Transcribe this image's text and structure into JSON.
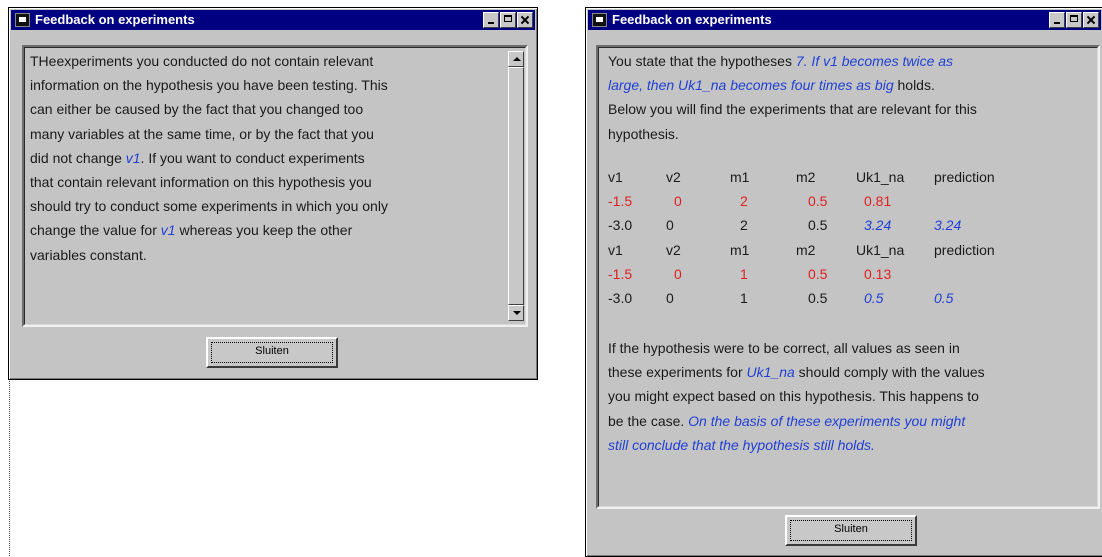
{
  "left_window": {
    "title": "Feedback on experiments",
    "text": [
      {
        "t": "THeexperiments you conducted do not contain relevant"
      },
      {
        "t": "information on the hypothesis you have been testing. This"
      },
      {
        "t": "can either be caused by the fact that you changed too"
      },
      {
        "t": "many variables at the same time, or by the fact that you"
      },
      {
        "a": "did not change ",
        "b": "v1",
        "c": ".  If you want to conduct experiments"
      },
      {
        "t": "that contain relevant information on this hypothesis you"
      },
      {
        "t": "should try to conduct some experiments in which you only"
      },
      {
        "a": "change the value for ",
        "b": "v1",
        "c": " whereas you keep the other"
      },
      {
        "t": "variables constant."
      }
    ],
    "button": "Sluiten"
  },
  "right_window": {
    "title": "Feedback on experiments",
    "intro": {
      "line1_a": "You state that the hypotheses ",
      "line1_b": "7. If v1 becomes twice as",
      "line2_b": "large, then Uk1_na becomes four times as big",
      "line2_c": " holds.",
      "line3": "Below you will find the experiments that are relevant for this",
      "line4": "hypothesis."
    },
    "tables": [
      {
        "headers": [
          "v1",
          "v2",
          "m1",
          "m2",
          "Uk1_na",
          "prediction"
        ],
        "rows": [
          {
            "v1": "-1.5",
            "v2": "0",
            "m1": "2",
            "m2": "0.5",
            "uk": "0.81",
            "pred": ""
          },
          {
            "v1": "-3.0",
            "v2": "0",
            "m1": "2",
            "m2": "0.5",
            "uk": "3.24",
            "pred": "3.24"
          }
        ]
      },
      {
        "headers": [
          "v1",
          "v2",
          "m1",
          "m2",
          "Uk1_na",
          "prediction"
        ],
        "rows": [
          {
            "v1": "-1.5",
            "v2": "0",
            "m1": "1",
            "m2": "0.5",
            "uk": "0.13",
            "pred": ""
          },
          {
            "v1": "-3.0",
            "v2": "0",
            "m1": "1",
            "m2": "0.5",
            "uk": "0.5",
            "pred": "0.5"
          }
        ]
      }
    ],
    "conclusion": {
      "line1": " If the hypothesis were to be correct, all values as seen in",
      "line2_a": "these experiments for ",
      "line2_b": "Uk1_na",
      "line2_c": "  should comply with the values",
      "line3": "you might expect based on this hypothesis. This happens to",
      "line4_a": "be the case. ",
      "line4_b": "On the basis of these experiments you might",
      "line5_b": "still conclude that the hypothesis still holds."
    },
    "button": "Sluiten"
  },
  "colors": {
    "titlebar": "#000080",
    "window_bg": "#c4c4c4",
    "highlight_blue": "#1f3fd6",
    "highlight_red": "#e02020"
  }
}
